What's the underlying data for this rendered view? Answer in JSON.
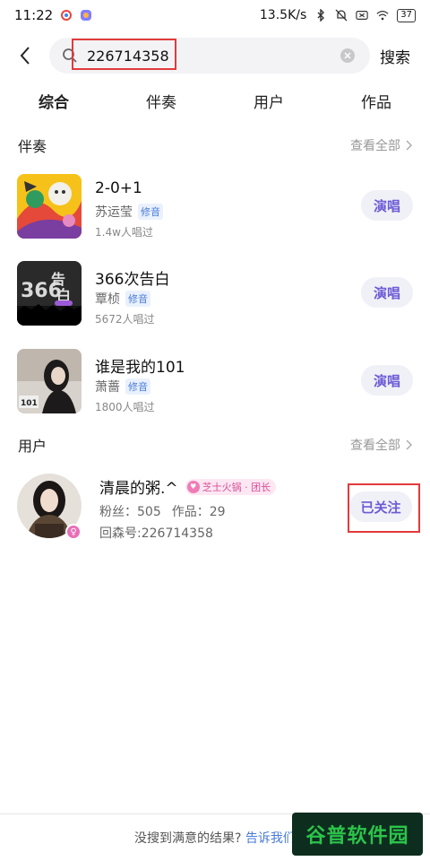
{
  "status_bar": {
    "time": "11:22",
    "net_speed": "13.5K/s",
    "battery": "37"
  },
  "search": {
    "value": "226714358",
    "placeholder": "",
    "button_label": "搜索"
  },
  "tabs": [
    {
      "label": "综合",
      "active": true
    },
    {
      "label": "伴奏",
      "active": false
    },
    {
      "label": "用户",
      "active": false
    },
    {
      "label": "作品",
      "active": false
    }
  ],
  "accompaniment_section": {
    "title": "伴奏",
    "see_all": "查看全部",
    "items": [
      {
        "title": "2-0+1",
        "artist": "苏运莹",
        "tag": "修音",
        "count": "1.4w人唱过",
        "action": "演唱"
      },
      {
        "title": "366次告白",
        "artist": "覃桢",
        "tag": "修音",
        "count": "5672人唱过",
        "action": "演唱"
      },
      {
        "title": "谁是我的101",
        "artist": "萧蔷",
        "tag": "修音",
        "count": "1800人唱过",
        "action": "演唱"
      }
    ]
  },
  "user_section": {
    "title": "用户",
    "see_all": "查看全部",
    "user": {
      "name": "清晨的粥.^",
      "badge": "芝士火锅 · 团长",
      "fans_label": "粉丝：505",
      "works_label": "作品：29",
      "id_label": "回森号:226714358",
      "follow_label": "已关注"
    }
  },
  "footer": {
    "text": "没搜到满意的结果?",
    "link": "告诉我们"
  },
  "watermark": "谷普软件园",
  "colors": {
    "accent": "#6b5bd6",
    "tab_underline": "#ffd84a",
    "highlight": "#e23a3a",
    "tag": "#4a7bd8"
  }
}
